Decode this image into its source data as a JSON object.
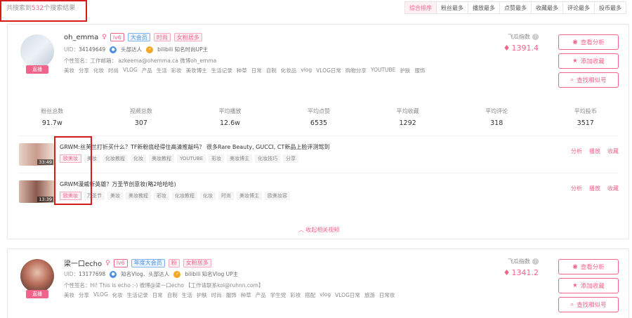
{
  "search": {
    "prefix": "共搜索到",
    "count": "532",
    "suffix": "个搜索结果"
  },
  "sort_tabs": [
    "综合排序",
    "粉丝最多",
    "播放最多",
    "点赞最多",
    "收藏最多",
    "评论最多",
    "投币最多"
  ],
  "active_sort": 0,
  "colors": {
    "accent": "#f1648a",
    "vip": "#4a90e2",
    "highlight": "#d81b1b"
  },
  "actions": {
    "analyze": "查看分析",
    "favorite": "添加收藏",
    "similar": "查找相似号"
  },
  "index_label": "飞瓜指数",
  "cards": [
    {
      "name": "oh_emma",
      "live": "直播",
      "badges": [
        "lv6",
        "大会员",
        "时尚",
        "女粉居多"
      ],
      "uid_label": "UID：",
      "uid": "34149649",
      "role1": "头部达人",
      "role2": "bilibili 知名时尚UP主",
      "signature": "个性签名：工作邮箱： azkeema@ohemma.ca  微博oh_emma",
      "tags": [
        "美妆",
        "分享",
        "化妆",
        "时尚",
        "VLOG",
        "产品",
        "生活",
        "彩妆",
        "美妆博主",
        "生活记录",
        "种草",
        "日常",
        "自制",
        "化妆品",
        "vlog",
        "VLOG日常",
        "购物分享",
        "YOUTUBE",
        "护肤",
        "服饰"
      ],
      "index_value": "1391.4",
      "stats": [
        {
          "label": "粉丝总数",
          "value": "91.7w"
        },
        {
          "label": "视频总数",
          "value": "307"
        },
        {
          "label": "平均播放",
          "value": "12.6w"
        },
        {
          "label": "平均点赞",
          "value": "6535"
        },
        {
          "label": "平均收藏",
          "value": "1292"
        },
        {
          "label": "平均评论",
          "value": "318"
        },
        {
          "label": "平均投币",
          "value": "3517"
        }
      ],
      "videos": [
        {
          "time": "33:49",
          "title": "GRWM:丝芙兰打折买什么？TF新粉底经得住高清推敲吗？ 很多Rare Beauty, GUCCI, CT新品上脸评测驾到",
          "tags": [
            "欧美妆",
            "美妆",
            "化妆教程",
            "化妆",
            "美妆教程",
            "YOUTUBE",
            "彩妆",
            "美妆博主",
            "化妆技巧",
            "分享"
          ]
        },
        {
          "time": "13:39",
          "title": "GRWM漫威新英雄？万圣节创意妆(略2哈哈哈)",
          "tags": [
            "欧美妆",
            "万圣节",
            "美妆",
            "美妆教程",
            "彩妆",
            "化妆教程",
            "化妆",
            "时尚",
            "美妆博主",
            "欧美妆容"
          ]
        }
      ],
      "video_actions": [
        "分析",
        "播放",
        "收藏"
      ],
      "collapse": "收起相关视频"
    },
    {
      "name": "梁一口echo",
      "live": "直播",
      "badges": [
        "lv6",
        "年度大会员",
        "粉",
        "女粉居多"
      ],
      "uid_label": "UID：",
      "uid": "13177698",
      "role1": "知名Vlog、头部达人",
      "role2": "bilibili 知名Vlog UP主",
      "signature": "个性签名：Hi! This is echo :-) 微博@梁一口echo 【工作请联系kol@ruhnn.com】",
      "tags": [
        "美妆",
        "分享",
        "VLOG",
        "化妆",
        "生活记录",
        "日常",
        "自制",
        "生活",
        "护肤",
        "时尚",
        "服饰",
        "种草",
        "产品",
        "学生党",
        "彩妆",
        "搭配",
        "vlog",
        "VLOG日常",
        "旅游",
        "日常妆"
      ],
      "index_value": "1341.2"
    }
  ]
}
